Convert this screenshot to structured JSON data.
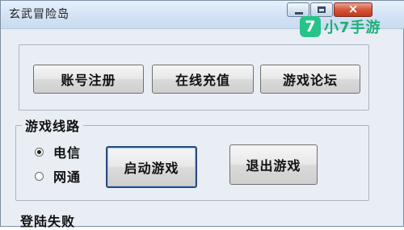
{
  "window": {
    "title": "玄武冒险岛",
    "close_glyph": "×"
  },
  "watermark": {
    "badge": "7",
    "text": "小7手游",
    "color": "#27c48a"
  },
  "buttons": {
    "register": "账号注册",
    "recharge": "在线充值",
    "forum": "游戏论坛",
    "start": "启动游戏",
    "quit": "退出游戏"
  },
  "route_group": {
    "legend": "游戏线路",
    "options": [
      {
        "label": "电信",
        "selected": true
      },
      {
        "label": "网通",
        "selected": false
      }
    ]
  },
  "status": {
    "text": "登陆失败"
  }
}
